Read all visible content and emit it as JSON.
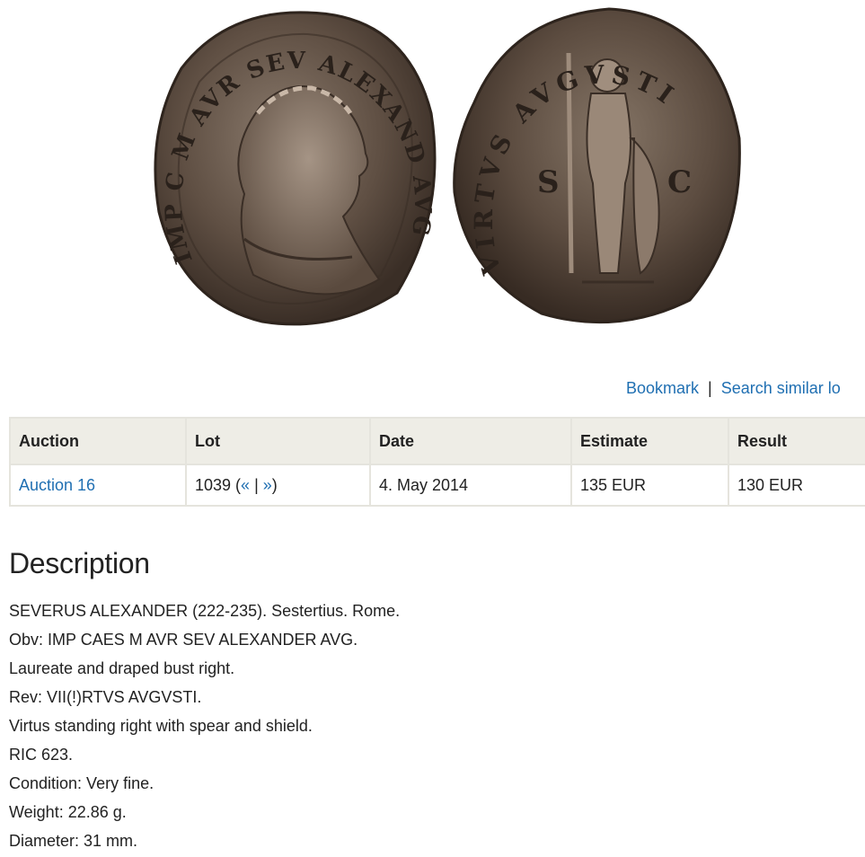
{
  "images": {
    "obverse": {
      "icon": "coin-obverse-image",
      "legend": "IMP C M AVR SEV ALEXAND AVG"
    },
    "reverse": {
      "icon": "coin-reverse-image",
      "legend": "VIRTVS AVGVSTI",
      "field_s": "S",
      "field_c": "C"
    }
  },
  "actions": {
    "bookmark": "Bookmark",
    "separator": "|",
    "search_similar": "Search similar lo"
  },
  "table": {
    "headers": [
      "Auction",
      "Lot",
      "Date",
      "Estimate",
      "Result"
    ],
    "row": {
      "auction": "Auction 16",
      "lot_number": "1039 (",
      "prev": "«",
      "lot_sep": " | ",
      "next": "»",
      "lot_close": ")",
      "date": "4. May 2014",
      "estimate": "135 EUR",
      "result": "130 EUR"
    }
  },
  "description": {
    "title": "Description",
    "lines": [
      "SEVERUS ALEXANDER (222-235). Sestertius. Rome.",
      "Obv: IMP CAES M AVR SEV ALEXANDER AVG.",
      "Laureate and draped bust right.",
      "Rev: VII(!)RTVS AVGVSTI.",
      "Virtus standing right with spear and shield.",
      "RIC 623.",
      "Condition: Very fine.",
      "Weight: 22.86 g.",
      "Diameter: 31 mm."
    ]
  },
  "colors": {
    "link": "#1f6fb2",
    "header_bg": "#eeede6",
    "border": "#e5e4dd",
    "coin_bronze": "#5a4a3e"
  }
}
